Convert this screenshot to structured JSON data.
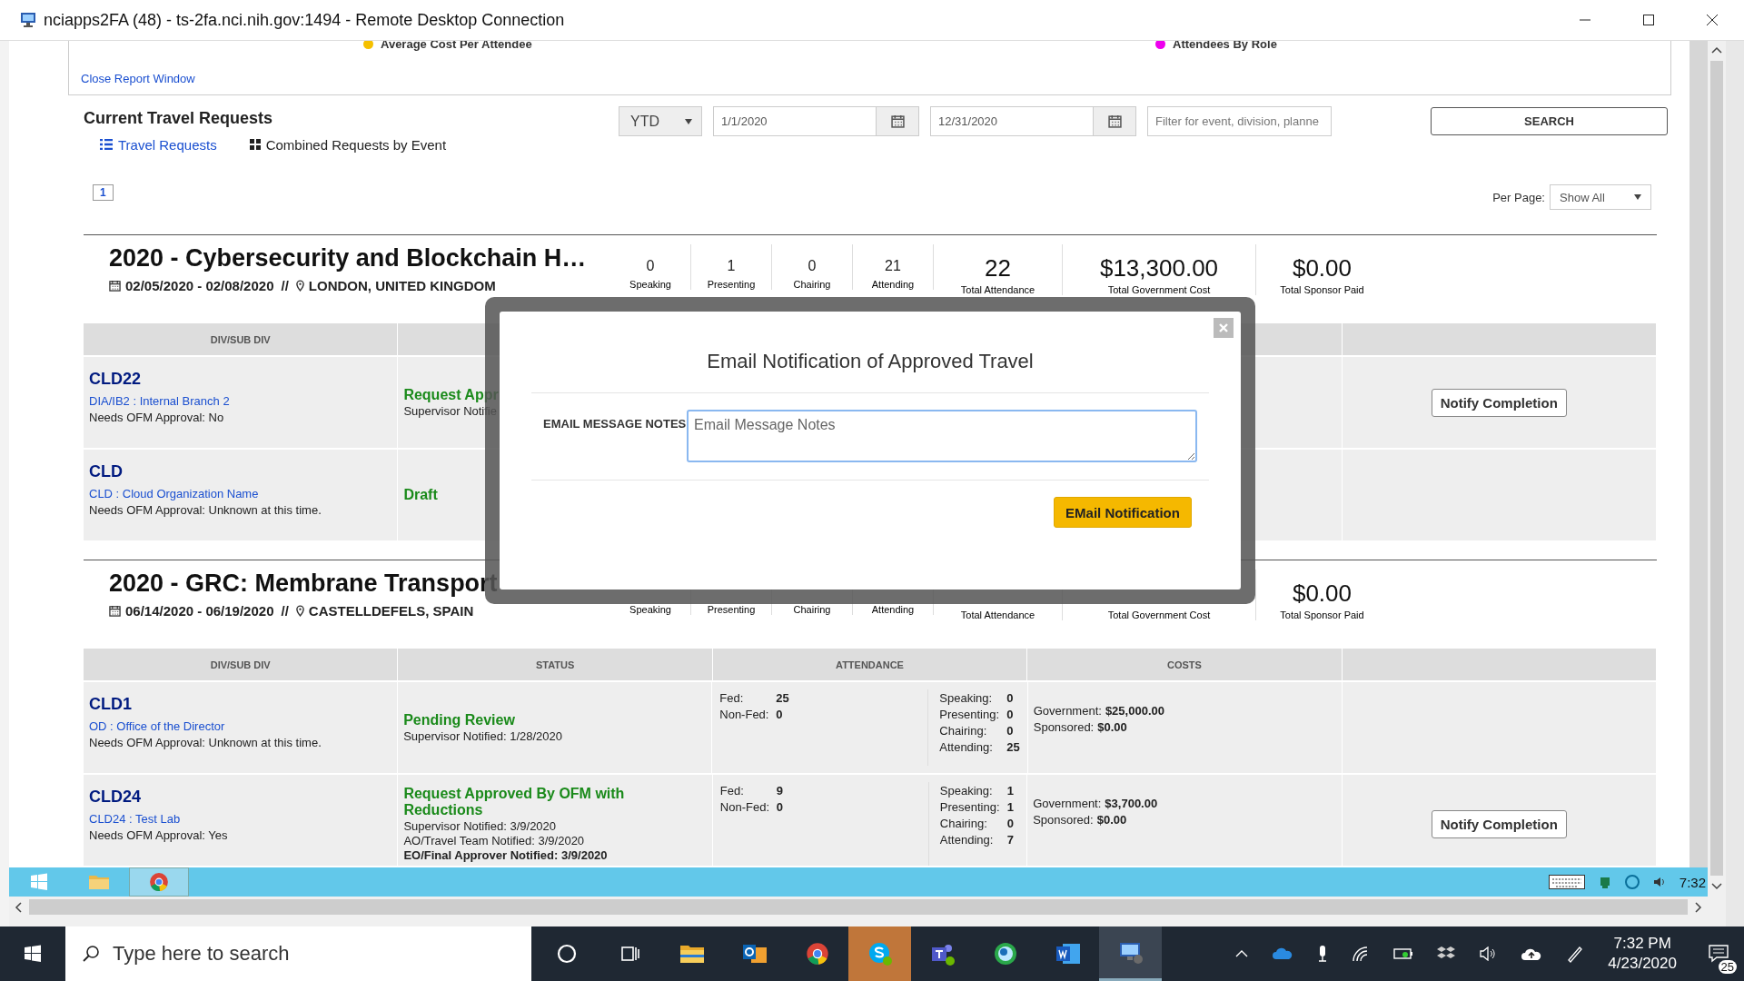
{
  "window": {
    "title": "nciapps2FA (48) - ts-2fa.nci.nih.gov:1494 - Remote Desktop Connection"
  },
  "report": {
    "legend": [
      {
        "label": "Average Cost Per Attendee",
        "color": "#f5c000"
      },
      {
        "label": "Attendees By Role",
        "color": "#ee00ee"
      }
    ],
    "close_link": "Close Report Window"
  },
  "heading": "Current Travel Requests",
  "filters": {
    "period": "YTD",
    "start_date": "1/1/2020",
    "end_date": "12/31/2020",
    "search_placeholder": "Filter for event, division, planne",
    "search_button": "SEARCH"
  },
  "tabs": [
    {
      "label": "Travel Requests",
      "selected": true,
      "kind": "list"
    },
    {
      "label": "Combined Requests by Event",
      "selected": false,
      "kind": "grid"
    }
  ],
  "pages": [
    {
      "label": "1",
      "selected": true
    }
  ],
  "per_page": {
    "label": "Per Page:",
    "value": "Show All"
  },
  "events": [
    {
      "title": "2020 - Cybersecurity and Blockchain H…",
      "dates": "02/05/2020 - 02/08/2020",
      "separator": "//",
      "location": "LONDON, UNITED KINGDOM",
      "role_counts": [
        {
          "value": "0",
          "label": "Speaking"
        },
        {
          "value": "1",
          "label": "Presenting"
        },
        {
          "value": "0",
          "label": "Chairing"
        },
        {
          "value": "21",
          "label": "Attending"
        }
      ],
      "totals": [
        {
          "value": "22",
          "label": "Total Attendance"
        },
        {
          "value": "$13,300.00",
          "label": "Total Government Cost"
        },
        {
          "value": "$0.00",
          "label": "Total Sponsor Paid"
        }
      ],
      "columns": [
        "DIV/SUB DIV"
      ],
      "rows": [
        {
          "code": "CLD22",
          "division": "DIA/IB2 : Internal Branch 2",
          "ofm": "Needs OFM Approval: No",
          "status": "Request Appr",
          "notes": [
            {
              "text": "Supervisor Notifie",
              "emphasis": false
            }
          ],
          "action": "Notify Completion"
        },
        {
          "code": "CLD",
          "division": "CLD : Cloud Organization Name",
          "ofm": "Needs OFM Approval: Unknown at this time.",
          "status": "Draft"
        }
      ]
    },
    {
      "title": "2020 - GRC: Membrane Transport",
      "dates": "06/14/2020 - 06/19/2020",
      "separator": "//",
      "location": "CASTELLDEFELS, SPAIN",
      "role_counts": [
        {
          "label": "Speaking"
        },
        {
          "label": "Presenting"
        },
        {
          "label": "Chairing"
        },
        {
          "label": "Attending"
        }
      ],
      "totals": [
        {
          "label": "Total Attendance"
        },
        {
          "label": "Total Government Cost"
        },
        {
          "value": "$0.00",
          "label": "Total Sponsor Paid"
        }
      ],
      "columns": [
        "DIV/SUB DIV",
        "STATUS",
        "ATTENDANCE",
        "COSTS"
      ],
      "rows": [
        {
          "code": "CLD1",
          "division": "OD : Office of the Director",
          "ofm": "Needs OFM Approval: Unknown at this time.",
          "status": "Pending Review",
          "notes": [
            {
              "text": "Supervisor Notified: 1/28/2020",
              "emphasis": false
            }
          ],
          "attendance": [
            {
              "label": "Fed:",
              "value": "25"
            },
            {
              "label": "Non-Fed:",
              "value": "0"
            }
          ],
          "roles": [
            {
              "label": "Speaking:",
              "value": "0"
            },
            {
              "label": "Presenting:",
              "value": "0"
            },
            {
              "label": "Chairing:",
              "value": "0"
            },
            {
              "label": "Attending:",
              "value": "25"
            }
          ],
          "costs": [
            {
              "label": "Government:",
              "value": "$25,000.00"
            },
            {
              "label": "Sponsored:",
              "value": "$0.00"
            }
          ]
        },
        {
          "code": "CLD24",
          "division": "CLD24 : Test Lab",
          "ofm": "Needs OFM Approval: Yes",
          "status": "Request Approved By OFM with Reductions",
          "notes": [
            {
              "text": "Supervisor Notified: 3/9/2020",
              "emphasis": false
            },
            {
              "text": "AO/Travel Team Notified: 3/9/2020",
              "emphasis": false
            },
            {
              "text": "EO/Final Approver Notified: 3/9/2020",
              "emphasis": true
            }
          ],
          "attendance": [
            {
              "label": "Fed:",
              "value": "9"
            },
            {
              "label": "Non-Fed:",
              "value": "0"
            }
          ],
          "roles": [
            {
              "label": "Speaking:",
              "value": "1"
            },
            {
              "label": "Presenting:",
              "value": "1"
            },
            {
              "label": "Chairing:",
              "value": "0"
            },
            {
              "label": "Attending:",
              "value": "7"
            }
          ],
          "costs": [
            {
              "label": "Government:",
              "value": "$3,700.00"
            },
            {
              "label": "Sponsored:",
              "value": "$0.00"
            }
          ],
          "action": "Notify Completion"
        }
      ]
    }
  ],
  "modal": {
    "title": "Email Notification of Approved Travel",
    "label": "EMAIL MESSAGE NOTES",
    "placeholder": "Email Message Notes",
    "button": "EMail Notification"
  },
  "remote_taskbar": {
    "apps": [
      {
        "kind": "start",
        "focused": false
      },
      {
        "kind": "folder",
        "focused": false
      },
      {
        "kind": "chrome",
        "focused": true
      }
    ],
    "time": "7:32"
  },
  "taskbar": {
    "search_placeholder": "Type here to search",
    "apps": [
      {
        "kind": "cortana",
        "flashing": false,
        "focused": false
      },
      {
        "kind": "taskview",
        "flashing": false,
        "focused": false
      },
      {
        "kind": "explorer",
        "flashing": false,
        "focused": false
      },
      {
        "kind": "outlook",
        "flashing": false,
        "focused": false
      },
      {
        "kind": "chrome",
        "flashing": false,
        "focused": false
      },
      {
        "kind": "skype",
        "flashing": true,
        "focused": false
      },
      {
        "kind": "teams",
        "flashing": false,
        "focused": false
      },
      {
        "kind": "sphere",
        "flashing": false,
        "focused": false
      },
      {
        "kind": "word",
        "flashing": false,
        "focused": false
      },
      {
        "kind": "remote",
        "flashing": false,
        "focused": true
      }
    ],
    "time": "7:32 PM",
    "date": "4/23/2020",
    "notifications": "25"
  }
}
